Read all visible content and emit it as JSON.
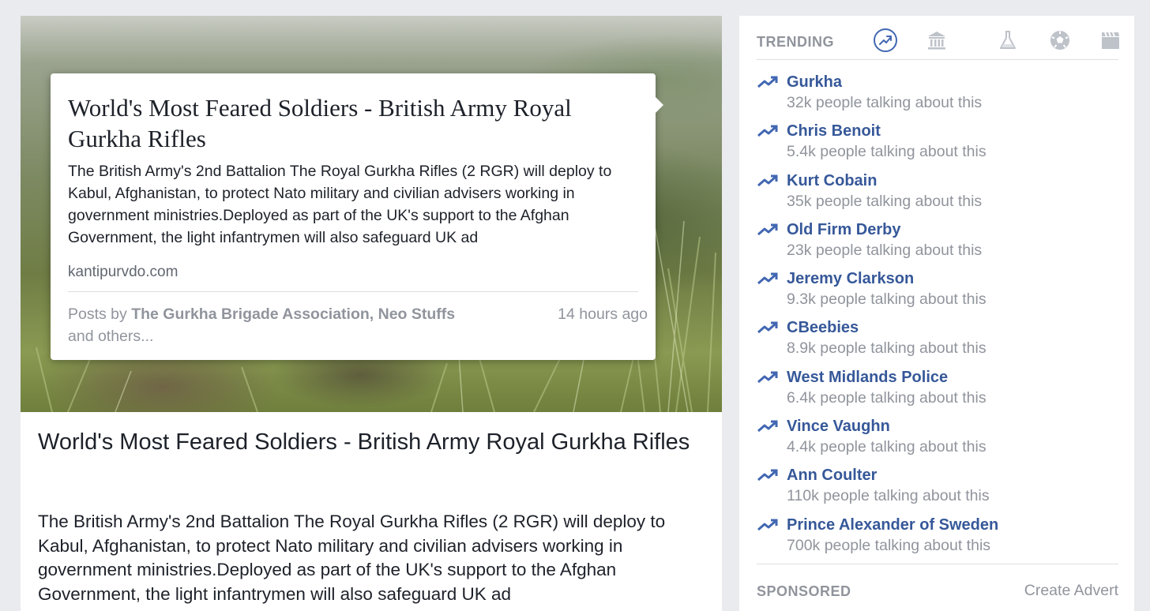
{
  "post": {
    "popover": {
      "title": "World's Most Feared Soldiers - British Army Royal Gurkha Rifles",
      "description": "The British Army's 2nd Battalion The Royal Gurkha Rifles (2 RGR) will deploy to Kabul, Afghanistan, to protect Nato military and civilian advisers working in government ministries.Deployed as part of the UK's support to the Afghan Government, the light infantrymen will also safeguard UK ad",
      "source": "kantipurvdo.com",
      "posts_by_prefix": "Posts by ",
      "posts_by_names": "The Gurkha Brigade Association, Neo Stuffs",
      "posts_by_suffix": " and others...",
      "time": "14 hours ago"
    },
    "title": "World's Most Feared Soldiers - British Army Royal Gurkha Rifles",
    "description": "The British Army's 2nd Battalion The Royal Gurkha Rifles (2 RGR) will deploy to Kabul, Afghanistan, to protect Nato military and civilian advisers working in government ministries.Deployed as part of the UK's support to the Afghan Government, the light infantrymen will also safeguard UK ad"
  },
  "trending": {
    "label": "TRENDING",
    "categories": [
      {
        "icon": "trending-icon",
        "active": true
      },
      {
        "icon": "politics-icon",
        "active": false
      },
      {
        "icon": "science-icon",
        "active": false
      },
      {
        "icon": "sports-icon",
        "active": false
      },
      {
        "icon": "entertainment-icon",
        "active": false
      }
    ],
    "items": [
      {
        "name": "Gurkha",
        "count": "32k people talking about this"
      },
      {
        "name": "Chris Benoit",
        "count": "5.4k people talking about this"
      },
      {
        "name": "Kurt Cobain",
        "count": "35k people talking about this"
      },
      {
        "name": "Old Firm Derby",
        "count": "23k people talking about this"
      },
      {
        "name": "Jeremy Clarkson",
        "count": "9.3k people talking about this"
      },
      {
        "name": "CBeebies",
        "count": "8.9k people talking about this"
      },
      {
        "name": "West Midlands Police",
        "count": "6.4k people talking about this"
      },
      {
        "name": "Vince Vaughn",
        "count": "4.4k people talking about this"
      },
      {
        "name": "Ann Coulter",
        "count": "110k people talking about this"
      },
      {
        "name": "Prince Alexander of Sweden",
        "count": "700k people talking about this"
      }
    ]
  },
  "sponsored": {
    "label": "SPONSORED",
    "create_advert": "Create Advert"
  },
  "colors": {
    "link": "#365899",
    "accent": "#4267b2",
    "muted": "#90949c",
    "text": "#1d2129",
    "background": "#e9ebee"
  }
}
